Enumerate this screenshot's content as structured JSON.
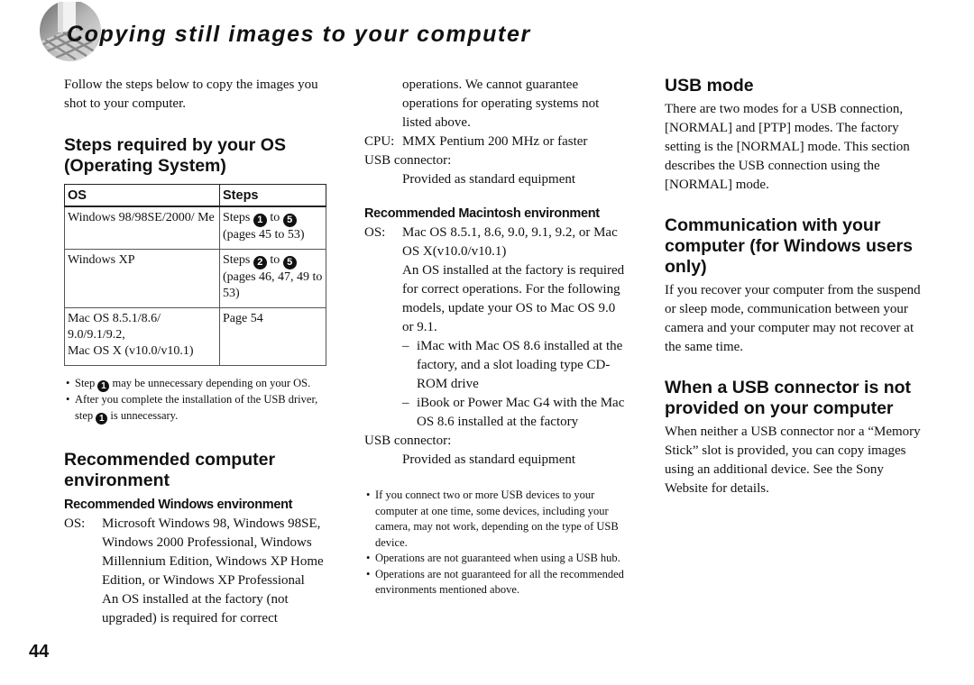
{
  "header": {
    "title": "Copying still images to your computer",
    "icon": "computer-graphic-icon"
  },
  "page_number": "44",
  "column1": {
    "intro": "Follow the steps below to copy the images you shot to your computer.",
    "steps_heading": "Steps required by your OS (Operating System)",
    "table": {
      "headers": [
        "OS",
        "Steps"
      ],
      "rows": [
        {
          "os": "Windows 98/98SE/2000/ Me",
          "steps_prefix": "Steps",
          "from": "1",
          "to_word": "to",
          "to": "5",
          "pages": "(pages 45 to 53)"
        },
        {
          "os": "Windows XP",
          "steps_prefix": "Steps",
          "from": "2",
          "to_word": "to",
          "to": "5",
          "pages": "(pages 46, 47, 49 to 53)"
        },
        {
          "os_lines": [
            "Mac OS 8.5.1/8.6/",
            "9.0/9.1/9.2,",
            "Mac OS X (v10.0/v10.1)"
          ],
          "page": "Page 54"
        }
      ]
    },
    "notes": [
      {
        "pre": "Step",
        "num": "1",
        "post": "may be unnecessary depending on your OS."
      },
      {
        "pre": "After you complete the installation of the USB driver, step",
        "num": "1",
        "post": "is unnecessary."
      }
    ],
    "rec_heading": "Recommended computer environment",
    "win_env_heading": "Recommended Windows environment",
    "win_os_label": "OS:",
    "win_os_value": "Microsoft Windows 98, Windows 98SE, Windows 2000 Professional, Windows Millennium Edition, Windows XP Home Edition, or Windows XP Professional",
    "win_os_note": "An OS installed at the factory (not upgraded) is required for correct"
  },
  "column2": {
    "win_os_note_cont": "operations. We cannot guarantee operations for operating systems not listed above.",
    "cpu_label": "CPU:",
    "cpu_value": "MMX Pentium 200 MHz or faster",
    "usb_label": "USB connector:",
    "usb_value": "Provided as standard equipment",
    "mac_env_heading": "Recommended Macintosh environment",
    "mac_os_label": "OS:",
    "mac_os_value": "Mac OS 8.5.1, 8.6, 9.0, 9.1, 9.2, or Mac OS X(v10.0/v10.1)",
    "mac_os_note": "An OS installed at the factory is required for correct operations. For the following models, update your OS to Mac OS 9.0 or 9.1.",
    "mac_models": [
      "iMac with Mac OS 8.6 installed at the factory, and a slot loading type CD-ROM drive",
      "iBook or Power Mac G4 with the Mac OS 8.6 installed at the factory"
    ],
    "mac_usb_label": "USB connector:",
    "mac_usb_value": "Provided as standard equipment",
    "notes": [
      "If you connect two or more USB devices to your computer at one time, some devices, including your camera, may not work, depending on the type of USB device.",
      "Operations are not guaranteed when using a USB hub.",
      "Operations are not guaranteed for all the recommended environments mentioned above."
    ]
  },
  "column3": {
    "usb_mode_heading": "USB mode",
    "usb_mode_text": "There are two modes for a USB connection, [NORMAL] and [PTP] modes. The factory setting is the [NORMAL] mode. This section describes the USB connection using the [NORMAL] mode.",
    "comm_heading": "Communication with your computer (for Windows users only)",
    "comm_text": "If you recover your computer from the suspend or sleep mode, communication between your camera and your computer may not recover at the same time.",
    "no_usb_heading": "When a USB connector is not provided on your computer",
    "no_usb_text": "When neither a USB connector nor a “Memory Stick” slot is provided, you can copy images using an additional device. See the Sony Website for details."
  }
}
